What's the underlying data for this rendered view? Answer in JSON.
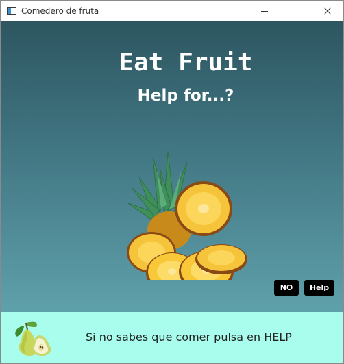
{
  "window": {
    "title": "Comedero de fruta",
    "controls": {
      "minimize": "minimize-icon",
      "maximize": "maximize-icon",
      "close": "close-icon"
    }
  },
  "main": {
    "heading": "Eat Fruit",
    "subheading": "Help for...?",
    "image": "pineapple-image",
    "buttons": {
      "no_label": "NO",
      "help_label": "Help"
    },
    "background_colors": [
      "#2d5660",
      "#5fa1ab"
    ]
  },
  "footer": {
    "icon": "pear-image",
    "message": "Si no sabes que comer pulsa en HELP",
    "background_color": "#a8fdec"
  }
}
